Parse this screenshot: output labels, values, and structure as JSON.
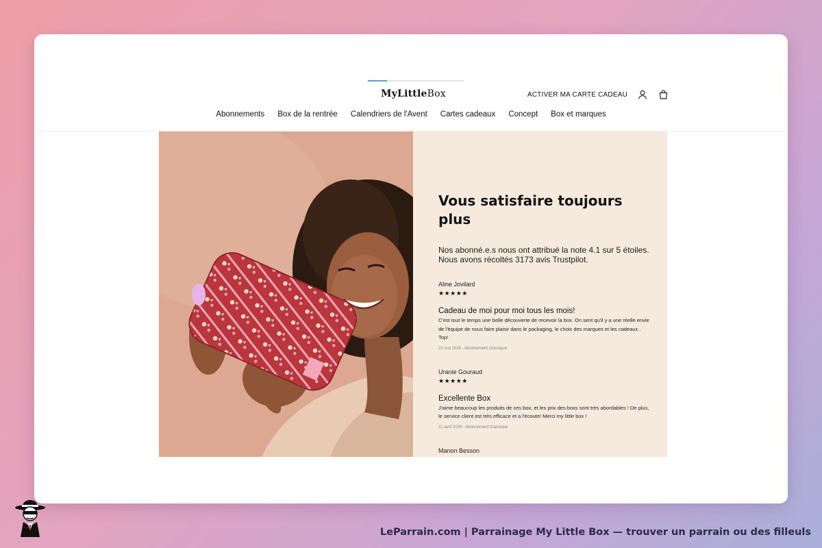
{
  "header": {
    "logo_part1": "My",
    "logo_part2": "Little",
    "logo_part3": "Box",
    "gift_card_link": "ACTIVER MA CARTE CADEAU",
    "account_icon": "user-icon",
    "cart_icon": "shopping-bag-icon",
    "progress": 0.2
  },
  "nav": {
    "items": [
      {
        "label": "Abonnements"
      },
      {
        "label": "Box de la rentrée"
      },
      {
        "label": "Calendriers de l'Avent"
      },
      {
        "label": "Cartes cadeaux"
      },
      {
        "label": "Concept"
      },
      {
        "label": "Box et marques"
      }
    ]
  },
  "hero": {
    "title": "Vous satisfaire toujours plus",
    "intro_line1": "Nos abonné.e.s nous ont attribué la note 4.1 sur 5 étoiles.",
    "intro_line2": "Nous avons récoltés 3173 avis Trustpilot."
  },
  "reviews": [
    {
      "author": "Aline Jovilard",
      "stars": "★★★★★",
      "title": "Cadeau de moi pour moi tous les mois!",
      "body": "C'est tout le temps une belle découverte de recevoir la box. On sent qu'il y a une réelle envie de l'équipe de nous faire plaisir dans le packaging, le choix des marques et les cadeaux . Top!",
      "meta": "22 mai 2026 - Abonnement Classique"
    },
    {
      "author": "Uranie Gouraud",
      "stars": "★★★★★",
      "title": "Excellente Box",
      "body": "J'aime beaucoup les produits de ces box, et les prix des boxs sont très abordables ! De plus, le service client est très efficace et a l'écoute! Merci my little box !",
      "meta": "21 avril 2026 - Abonnement Classique"
    },
    {
      "author": "Manon Besson"
    }
  ],
  "footer": {
    "caption": "LeParrain.com | Parrainage My Little Box — trouver un parrain ou des filleuls"
  },
  "colors": {
    "panel_bg": "#f6e9dd",
    "accent_blue": "#5a9fd4",
    "pouch_red": "#b8363c",
    "pouch_pink": "#f2a8b8"
  }
}
